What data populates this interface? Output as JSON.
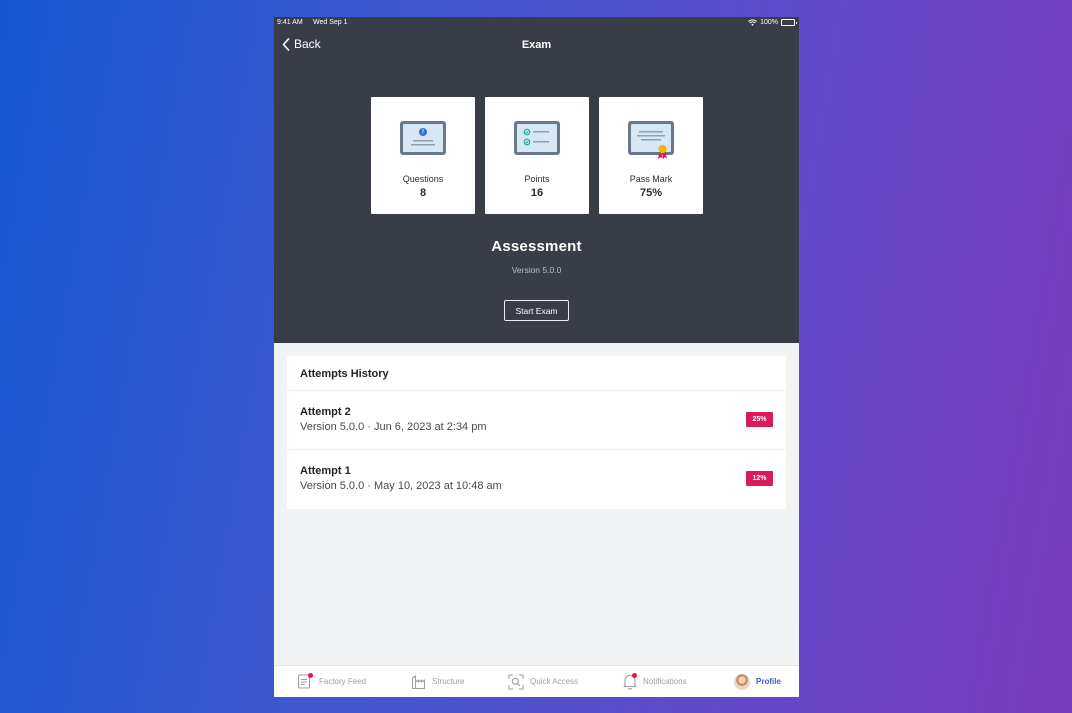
{
  "status_bar": {
    "time": "9:41 AM",
    "date": "Wed Sep 1",
    "battery": "100%"
  },
  "nav": {
    "back_label": "Back",
    "title": "Exam"
  },
  "stats": [
    {
      "icon": "question-tablet-icon",
      "label": "Questions",
      "value": "8"
    },
    {
      "icon": "checklist-tablet-icon",
      "label": "Points",
      "value": "16"
    },
    {
      "icon": "certificate-icon",
      "label": "Pass Mark",
      "value": "75%"
    }
  ],
  "exam": {
    "title": "Assessment",
    "version": "Version 5.0.0",
    "start_label": "Start Exam"
  },
  "history": {
    "title": "Attempts History",
    "attempts": [
      {
        "title": "Attempt 2",
        "meta": "Version 5.0.0 · Jun 6, 2023 at 2:34 pm",
        "score": "25%"
      },
      {
        "title": "Attempt 1",
        "meta": "Version 5.0.0 · May 10, 2023 at 10:48 am",
        "score": "12%"
      }
    ]
  },
  "tabs": [
    {
      "label": "Factory Feed",
      "icon": "feed-icon",
      "badge": true
    },
    {
      "label": "Structure",
      "icon": "structure-icon",
      "badge": false
    },
    {
      "label": "Quick Access",
      "icon": "scan-icon",
      "badge": false
    },
    {
      "label": "Notifications",
      "icon": "bell-icon",
      "badge": true
    },
    {
      "label": "Profile",
      "icon": "avatar",
      "active": true
    }
  ],
  "colors": {
    "hero_bg": "#383d47",
    "accent": "#3d5bd1",
    "score_badge": "#d81a5c",
    "page_bg": "#f2f3f5"
  }
}
